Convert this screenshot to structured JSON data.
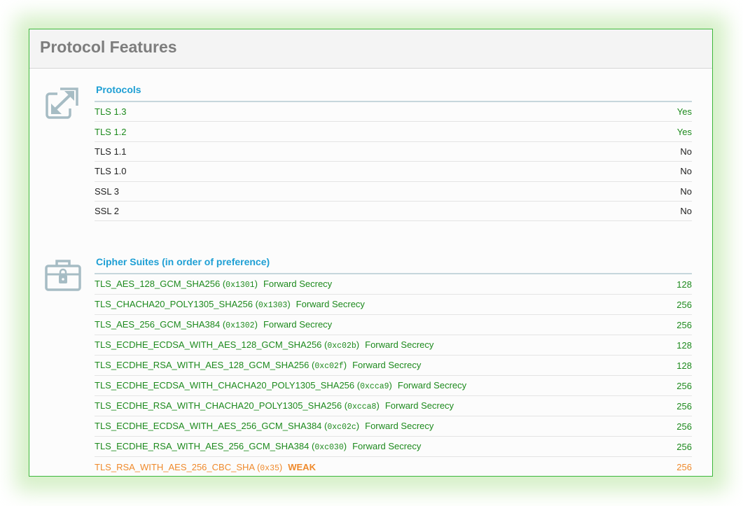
{
  "page_title": "Protocol Features",
  "protocols": {
    "heading": "Protocols",
    "rows": [
      {
        "name": "TLS 1.3",
        "value": "Yes",
        "status": "supported"
      },
      {
        "name": "TLS 1.2",
        "value": "Yes",
        "status": "supported"
      },
      {
        "name": "TLS 1.1",
        "value": "No",
        "status": "unsupported"
      },
      {
        "name": "TLS 1.0",
        "value": "No",
        "status": "unsupported"
      },
      {
        "name": "SSL 3",
        "value": "No",
        "status": "unsupported"
      },
      {
        "name": "SSL 2",
        "value": "No",
        "status": "unsupported"
      }
    ]
  },
  "ciphers": {
    "heading": "Cipher Suites (in order of preference)",
    "rows": [
      {
        "name": "TLS_AES_128_GCM_SHA256",
        "code": "0x1301",
        "note": "Forward Secrecy",
        "bits": "128",
        "weak": false
      },
      {
        "name": "TLS_CHACHA20_POLY1305_SHA256",
        "code": "0x1303",
        "note": "Forward Secrecy",
        "bits": "256",
        "weak": false
      },
      {
        "name": "TLS_AES_256_GCM_SHA384",
        "code": "0x1302",
        "note": "Forward Secrecy",
        "bits": "256",
        "weak": false
      },
      {
        "name": "TLS_ECDHE_ECDSA_WITH_AES_128_GCM_SHA256",
        "code": "0xc02b",
        "note": "Forward Secrecy",
        "bits": "128",
        "weak": false
      },
      {
        "name": "TLS_ECDHE_RSA_WITH_AES_128_GCM_SHA256",
        "code": "0xc02f",
        "note": "Forward Secrecy",
        "bits": "128",
        "weak": false
      },
      {
        "name": "TLS_ECDHE_ECDSA_WITH_CHACHA20_POLY1305_SHA256",
        "code": "0xcca9",
        "note": "Forward Secrecy",
        "bits": "256",
        "weak": false
      },
      {
        "name": "TLS_ECDHE_RSA_WITH_CHACHA20_POLY1305_SHA256",
        "code": "0xcca8",
        "note": "Forward Secrecy",
        "bits": "256",
        "weak": false
      },
      {
        "name": "TLS_ECDHE_ECDSA_WITH_AES_256_GCM_SHA384",
        "code": "0xc02c",
        "note": "Forward Secrecy",
        "bits": "256",
        "weak": false
      },
      {
        "name": "TLS_ECDHE_RSA_WITH_AES_256_GCM_SHA384",
        "code": "0xc030",
        "note": "Forward Secrecy",
        "bits": "256",
        "weak": false
      },
      {
        "name": "TLS_RSA_WITH_AES_256_CBC_SHA",
        "code": "0x35",
        "note": "WEAK",
        "bits": "256",
        "weak": true
      }
    ]
  },
  "icons": {
    "protocols": "expand-arrows-icon",
    "ciphers": "toolbox-lock-icon"
  },
  "colors": {
    "frame_border": "#3db83d",
    "heading_blue": "#1e9fd4",
    "supported_green": "#1d8a1d",
    "weak_orange": "#ef8a2c",
    "title_gray": "#7d7d7d"
  }
}
